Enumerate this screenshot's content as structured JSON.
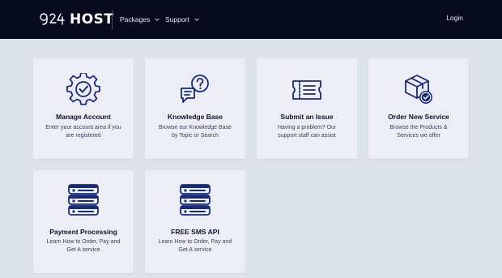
{
  "brand": {
    "name": "HOST",
    "mark": "924"
  },
  "nav": {
    "packages": "Packages",
    "support": "Support",
    "login": "Login"
  },
  "cards": [
    {
      "title": "Manage Account",
      "desc": "Enter your account area if you are registered",
      "icon": "gear-check-icon"
    },
    {
      "title": "Knowledge Base",
      "desc": "Browse our Knowledge Base by Topic or Search",
      "icon": "question-chat-icon"
    },
    {
      "title": "Submit an Issue",
      "desc": "Having a problem? Our support staff can assist",
      "icon": "ticket-list-icon"
    },
    {
      "title": "Order New Service",
      "desc": "Browse the Products & Services we offer",
      "icon": "box-check-icon"
    },
    {
      "title": "Payment Processing",
      "desc": "Learn How to Order, Pay and Get A service",
      "icon": "server-stack-icon"
    },
    {
      "title": "FREE SMS API",
      "desc": "Learn How to Order, Pay and Get A service",
      "icon": "server-stack-icon"
    }
  ],
  "colors": {
    "topbar": "#070a1c",
    "background": "#dde2ec",
    "card": "#ecedf5",
    "icon": "#1a2a7a"
  }
}
